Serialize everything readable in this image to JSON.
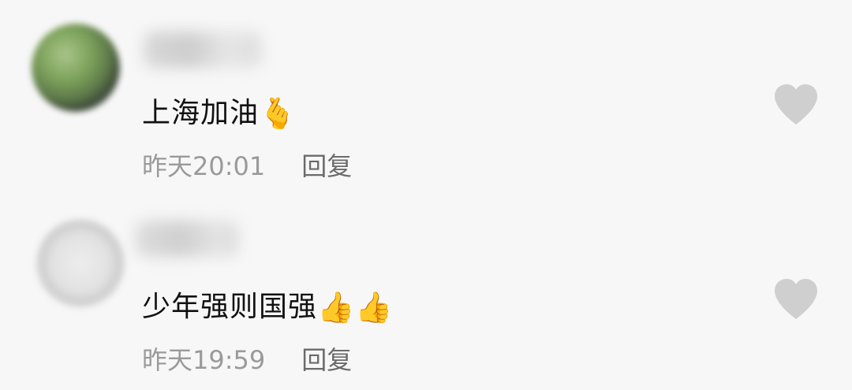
{
  "comments": [
    {
      "text": "上海加油",
      "emojis": "🫰",
      "time": "昨天20:01",
      "reply_label": "回复",
      "like_icon": "heart-icon",
      "avatar": "user-avatar (blurred, green)"
    },
    {
      "text": "少年强则国强",
      "emojis": "👍👍",
      "time": "昨天19:59",
      "reply_label": "回复",
      "like_icon": "heart-icon",
      "avatar": "user-avatar (blurred, gray)"
    }
  ],
  "colors": {
    "background": "#f7f7f7",
    "text": "#111111",
    "meta": "#9a9a9a",
    "reply": "#6b6b6b",
    "heart": "#cfcfcf"
  }
}
